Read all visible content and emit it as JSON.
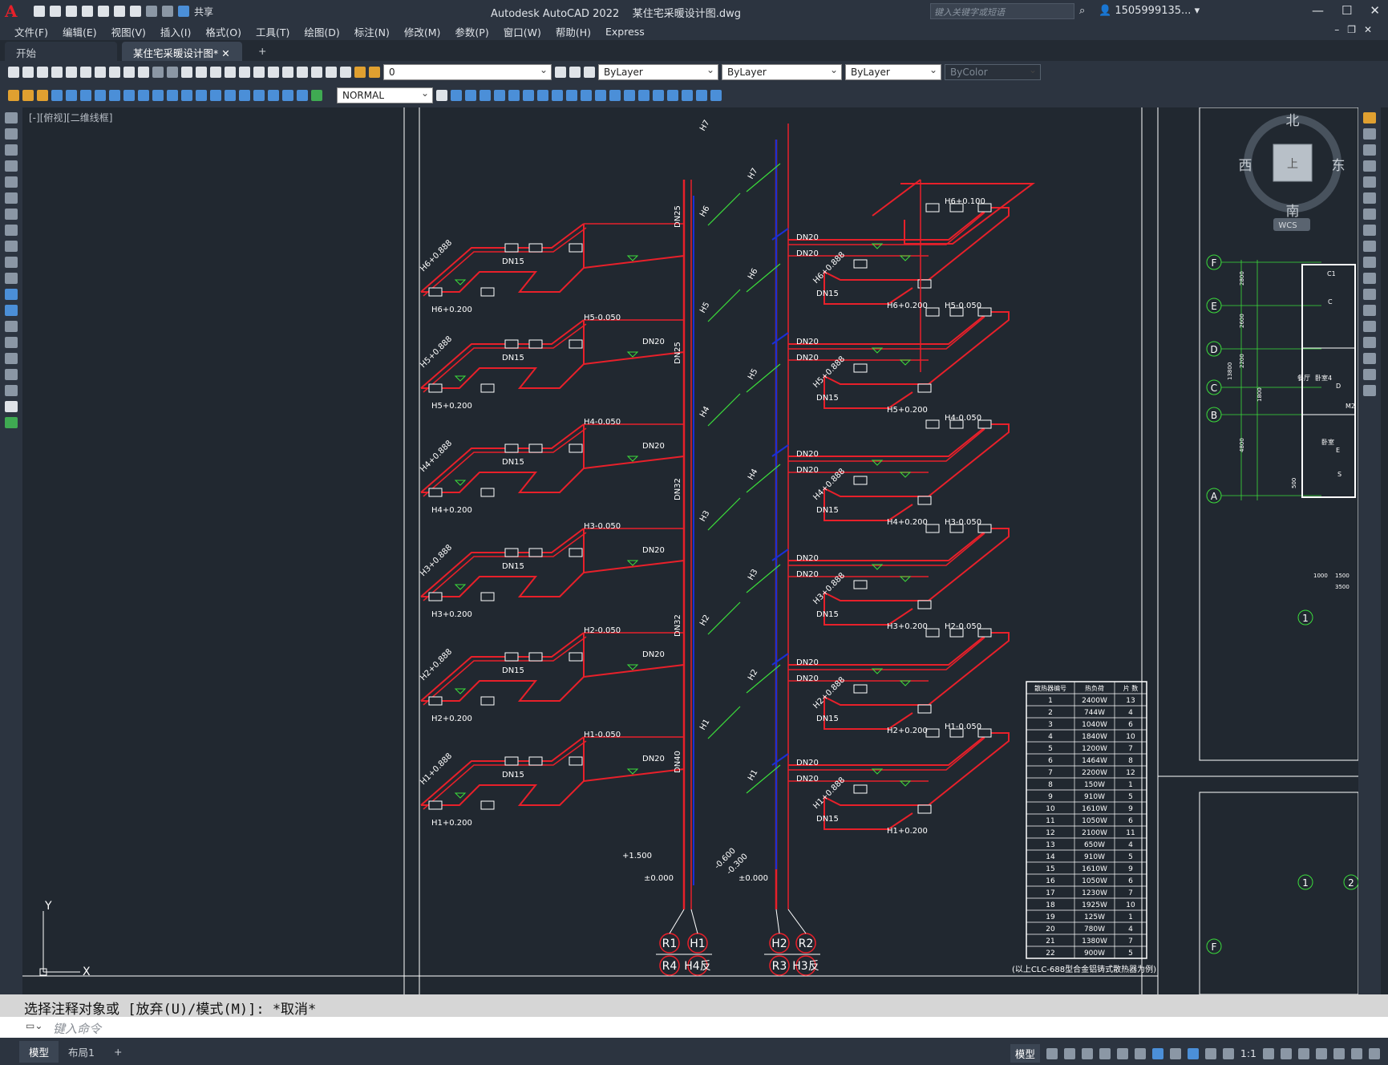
{
  "app": {
    "product": "Autodesk AutoCAD 2022",
    "file": "某住宅采暖设计图.dwg",
    "search_placeholder": "键入关键字或短语",
    "user": "1505999135...",
    "share": "共享"
  },
  "menu": [
    "文件(F)",
    "编辑(E)",
    "视图(V)",
    "插入(I)",
    "格式(O)",
    "工具(T)",
    "绘图(D)",
    "标注(N)",
    "修改(M)",
    "参数(P)",
    "窗口(W)",
    "帮助(H)",
    "Express"
  ],
  "tabs": [
    {
      "label": "开始",
      "active": false
    },
    {
      "label": "某住宅采暖设计图*",
      "active": true
    }
  ],
  "toolbar": {
    "layer_value": "0",
    "color_value": "ByLayer",
    "linetype_value": "ByLayer",
    "lineweight_value": "ByLayer",
    "plotstyle_value": "ByColor",
    "dimstyle_value": "NORMAL"
  },
  "viewport": {
    "label": "[-][俯视][二维线框]",
    "viewcube": {
      "north": "北",
      "south": "南",
      "east": "东",
      "west": "西",
      "face": "上",
      "wcs": "WCS"
    },
    "ucs": {
      "x": "X",
      "y": "Y"
    }
  },
  "drawing": {
    "risers": {
      "left": {
        "supply": "H7",
        "labels": [
          "H6",
          "H5",
          "H4",
          "H3",
          "H2",
          "H1"
        ],
        "pipe_sizes": [
          "DN25",
          "DN25",
          "DN32",
          "DN32",
          "DN40"
        ]
      },
      "right": {
        "labels": [
          "H7",
          "H6",
          "H5",
          "H4",
          "H3",
          "H2",
          "H1"
        ]
      }
    },
    "elevations_left": [
      "H6+0.888",
      "H6+0.200",
      "H5+0.888",
      "H5+0.200",
      "H4+0.888",
      "H4+0.200",
      "H3+0.888",
      "H3+0.200",
      "H2+0.888",
      "H2+0.200",
      "H1+0.888",
      "H1+0.200"
    ],
    "floor_labels_left": [
      "H5-0.050",
      "H4-0.050",
      "H3-0.050",
      "H2-0.050",
      "H1-0.050"
    ],
    "elevations_right": [
      "H6+0.100",
      "H6+0.888",
      "H6+0.200",
      "H5-0.050",
      "H5+0.888",
      "H5+0.200",
      "H4-0.050",
      "H4+0.888",
      "H4+0.200",
      "H3-0.050",
      "H3+0.888",
      "H3+0.200",
      "H2-0.050",
      "H2+0.888",
      "H2+0.200",
      "H1-0.050",
      "H1+0.888",
      "H1+0.200"
    ],
    "ground": [
      "±0.000",
      "+1.500",
      "-0.600",
      "-0.300"
    ],
    "circles": [
      {
        "top": "R1",
        "bottom": "R4"
      },
      {
        "top": "H1",
        "bottom": "H4反"
      },
      {
        "top": "H2",
        "bottom": "R3"
      },
      {
        "top": "R2",
        "bottom": "H3反"
      }
    ],
    "dn_labels": [
      "DN15",
      "DN20",
      "DN25"
    ]
  },
  "schedule": {
    "headers": [
      "散热器编号",
      "热负荷",
      "片 数"
    ],
    "rows": [
      [
        "1",
        "2400W",
        "13"
      ],
      [
        "2",
        "744W",
        "4"
      ],
      [
        "3",
        "1040W",
        "6"
      ],
      [
        "4",
        "1840W",
        "10"
      ],
      [
        "5",
        "1200W",
        "7"
      ],
      [
        "6",
        "1464W",
        "8"
      ],
      [
        "7",
        "2200W",
        "12"
      ],
      [
        "8",
        "150W",
        "1"
      ],
      [
        "9",
        "910W",
        "5"
      ],
      [
        "10",
        "1610W",
        "9"
      ],
      [
        "11",
        "1050W",
        "6"
      ],
      [
        "12",
        "2100W",
        "11"
      ],
      [
        "13",
        "650W",
        "4"
      ],
      [
        "14",
        "910W",
        "5"
      ],
      [
        "15",
        "1610W",
        "9"
      ],
      [
        "16",
        "1050W",
        "6"
      ],
      [
        "17",
        "1230W",
        "7"
      ],
      [
        "18",
        "1925W",
        "10"
      ],
      [
        "19",
        "125W",
        "1"
      ],
      [
        "20",
        "780W",
        "4"
      ],
      [
        "21",
        "1380W",
        "7"
      ],
      [
        "22",
        "900W",
        "5"
      ]
    ],
    "note": "(以上CLC-688型合金铝铸式散热器为例)"
  },
  "plan": {
    "axes_letters": [
      "F",
      "E",
      "D",
      "C",
      "B",
      "A"
    ],
    "axes_numbers": [
      "1",
      "2"
    ],
    "dims": [
      "2800",
      "2600",
      "2200",
      "1800",
      "4800",
      "13800",
      "500",
      "1000",
      "1500",
      "3500"
    ],
    "rooms": [
      "C1",
      "C",
      "卧室",
      "D",
      "M2",
      "卧室",
      "E",
      "S",
      "餐厅",
      "4"
    ]
  },
  "command": {
    "history": "选择注释对象或 [放弃(U)/模式(M)]: *取消*",
    "placeholder": "键入命令"
  },
  "statusbar": {
    "tabs": [
      {
        "label": "模型",
        "active": true
      },
      {
        "label": "布局1",
        "active": false
      }
    ],
    "model": "模型",
    "scale": "1:1"
  },
  "colors": {
    "pipe_supply": "#e8202a",
    "pipe_return": "#1a2fd6",
    "annotation": "#3bdc3b",
    "text": "#ffffff",
    "background": "#212830"
  }
}
